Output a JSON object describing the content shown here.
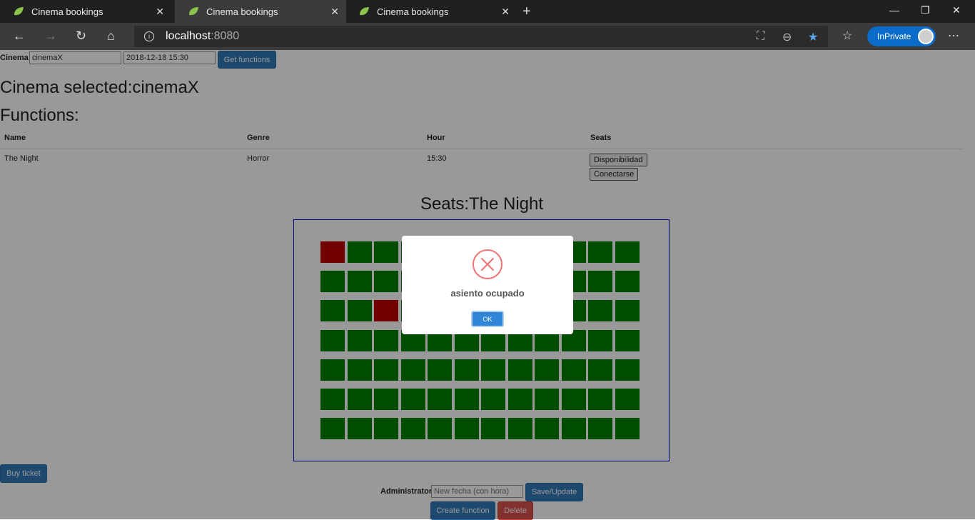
{
  "browser": {
    "tabs": [
      {
        "title": "Cinema bookings",
        "active": false
      },
      {
        "title": "Cinema bookings",
        "active": true
      },
      {
        "title": "Cinema bookings",
        "active": false
      }
    ],
    "url_host": "localhost",
    "url_port": ":8080",
    "inprivate_label": "InPrivate"
  },
  "form": {
    "cinema_label": "Cinema",
    "cinema_value": "cinemaX",
    "date_value": "2018-12-18 15:30",
    "get_functions_label": "Get functions"
  },
  "page": {
    "cinema_selected": "Cinema selected:cinemaX",
    "functions_heading": "Functions:"
  },
  "functions_table": {
    "headers": [
      "Name",
      "Genre",
      "Hour",
      "Seats"
    ],
    "rows": [
      {
        "name": "The Night",
        "genre": "Horror",
        "hour": "15:30",
        "buttons": [
          "Disponibilidad",
          "Conectarse"
        ]
      }
    ]
  },
  "seats": {
    "title": "Seats:The Night",
    "rows": 7,
    "cols": 12,
    "occupied": [
      [
        0,
        0
      ],
      [
        2,
        2
      ]
    ],
    "colors": {
      "free": "#008000",
      "occupied": "#c00000"
    }
  },
  "actions": {
    "buy_ticket": "Buy ticket",
    "administrator_label": "Administrator",
    "new_date_placeholder": "New fecha (con hora)",
    "save_update": "Save/Update",
    "create_function": "Create function",
    "delete": "Delete"
  },
  "modal": {
    "icon": "error-x-icon",
    "message": "asiento ocupado",
    "ok_label": "OK"
  }
}
